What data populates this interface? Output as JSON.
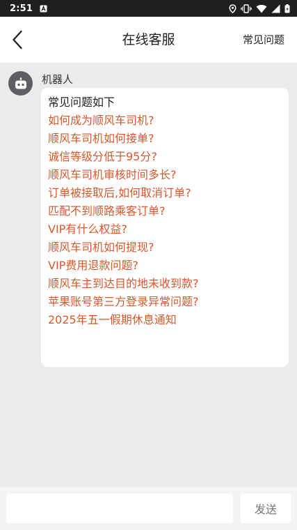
{
  "status_bar": {
    "time": "2:51",
    "icons": [
      "notification-a-icon",
      "location-icon",
      "vibrate-icon",
      "wifi-icon",
      "signal-icon",
      "battery-icon"
    ]
  },
  "app_bar": {
    "title": "在线客服",
    "action_label": "常见问题",
    "back_icon": "chevron-left-icon"
  },
  "message": {
    "sender": "机器人",
    "avatar_icon": "robot-icon",
    "heading": "常见问题如下",
    "questions": [
      "如何成为顺风车司机?",
      "顺风车司机如何接单?",
      "诚信等级分低于95分?",
      "顺风车司机审核时间多长?",
      "订单被接取后,如何取消订单?",
      "匹配不到顺路乘客订单?",
      "VIP有什么权益?",
      "顺风车司机如何提现?",
      "VIP费用退款问题?",
      "顺风车主到达目的地未收到款?",
      "苹果账号第三方登录异常问题?",
      "2025年五一假期休息通知"
    ]
  },
  "input_bar": {
    "input_value": "",
    "send_label": "发送"
  },
  "colors": {
    "status_bar": "#1f1f1f",
    "link": "#d9582b",
    "chat_background": "#ebebeb",
    "avatar": "#5d5f62"
  }
}
